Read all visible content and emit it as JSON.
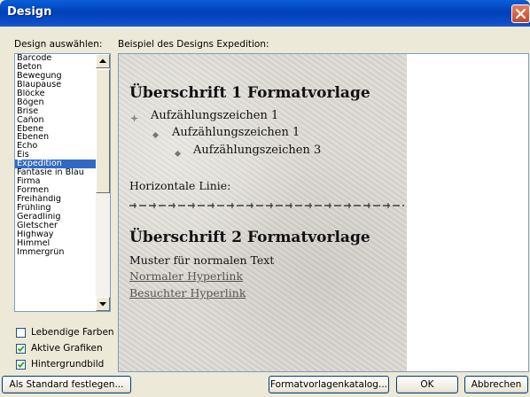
{
  "window": {
    "title": "Design"
  },
  "labels": {
    "select_design": "Design auswählen:",
    "preview_caption": "Beispiel des Designs Expedition:"
  },
  "design_list": {
    "items": [
      "Barcode",
      "Beton",
      "Bewegung",
      "Blaupause",
      "Blöcke",
      "Bögen",
      "Brise",
      "Cañon",
      "Ebene",
      "Ebenen",
      "Echo",
      "Eis",
      "Expedition",
      "Fantasie in Blau",
      "Firma",
      "Formen",
      "Freihändig",
      "Frühling",
      "Geradlinig",
      "Gletscher",
      "Highway",
      "Himmel",
      "Immergrün"
    ],
    "selected": "Expedition"
  },
  "options": [
    {
      "label": "Lebendige Farben",
      "checked": false
    },
    {
      "label": "Aktive Grafiken",
      "checked": true
    },
    {
      "label": "Hintergrundbild",
      "checked": true
    }
  ],
  "preview": {
    "heading1": "Überschrift 1 Formatvorlage",
    "bullet1": "Aufzählungszeichen 1",
    "bullet2": "Aufzählungszeichen 1",
    "bullet3": "Aufzählungszeichen 3",
    "horizontal_line_label": "Horizontale Linie:",
    "heading2": "Überschrift 2 Formatvorlage",
    "normal_text": "Muster für normalen Text",
    "link": "Normaler Hyperlink",
    "visited_link": "Besuchter Hyperlink"
  },
  "buttons": {
    "set_default": "Als Standard festlegen...",
    "style_gallery": "Formatvorlagenkatalog...",
    "ok": "OK",
    "cancel": "Abbrechen"
  },
  "colors": {
    "titlebar": "#0a4ec8",
    "selection": "#316ac5",
    "dialog_bg": "#ece9d8"
  },
  "icons": {
    "close": "close-icon",
    "scroll_up": "arrow-up-icon",
    "scroll_down": "arrow-down-icon",
    "bullet": "bullet-ornament-icon"
  }
}
